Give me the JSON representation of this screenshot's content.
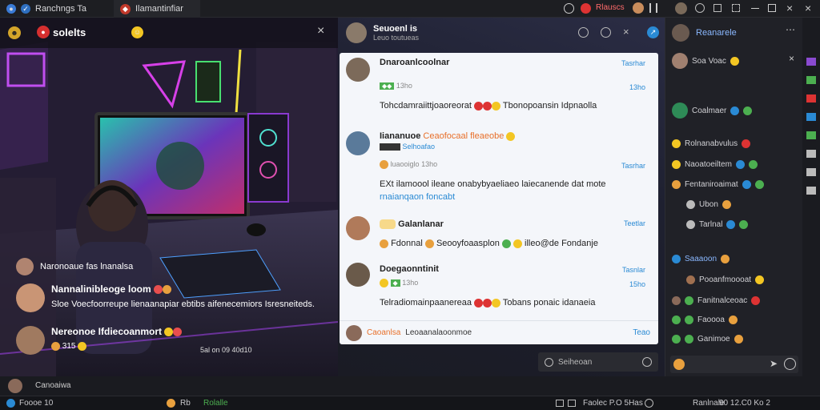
{
  "tabs": [
    {
      "label": "Ranchngs Ta",
      "icon": "app-icon"
    },
    {
      "label": "Ilamantinfiar",
      "icon": "game-icon"
    }
  ],
  "titlebar": {
    "badge_label": "Rlauscs",
    "icons": [
      "clock-icon",
      "notification-icon",
      "avatar-icon",
      "profile-icon",
      "settings-icon",
      "grid-icon",
      "minimize-icon",
      "maximize-icon",
      "close-icon"
    ]
  },
  "stream": {
    "channel": "solelts",
    "close_icon": "close-icon",
    "overlay": [
      {
        "name": "Naronoaue fas lnanalsa",
        "text": ""
      },
      {
        "name": "Nannalinibleoge loom",
        "text": "Sloe Voecfoorreupe lienaanapiar ebtibs aifenecemiors Isresneiteds."
      },
      {
        "name": "Nereonoe Ifdiecoanmort",
        "text": "315"
      }
    ],
    "overlay_time": "5al on 09 40d10",
    "bottom_user": "Canoaiwa"
  },
  "mid": {
    "header_name": "Seuoenl is",
    "header_sub": "Leuo toutueas",
    "comments": [
      {
        "name": "Dnaroanlcoolnar",
        "meta": "13ho",
        "reply": "Tasrhar",
        "body": "Tohcdamraiittjoaoreorat",
        "body2": "Tbonopoansin Idpnaolla",
        "time": "13ho"
      },
      {
        "name": "Iiananuoe",
        "tag": "Ceaofocaal fleaeobe",
        "reply": "",
        "sub": "Selhoafao",
        "meta": "luaooiglo",
        "body": "EXt ilamoool ileane onabybyaeliaeo laiecanende dat mote",
        "body2": "rnaianqaon foncabt",
        "time": "13ho",
        "reply2": "Tasrhar"
      },
      {
        "name": "Galanlanar",
        "meta": "",
        "reply": "Teetlar",
        "body": "Fdonnal",
        "body2": "Seooyfoaasplon",
        "body3": "illeo@de Fondanje",
        "time": ""
      },
      {
        "name": "Doegaonntinit",
        "meta": "",
        "reply": "Tasnlar",
        "body": "Telradiomainpaanereaa",
        "body2": "Tobans ponaic idanaeia",
        "time": "13ho",
        "time2": "15ho"
      }
    ],
    "footer_name": "Caoanlsa",
    "footer_text": "Leoaanalaoonmoe",
    "footer_reply": "Teao",
    "input_placeholder": "Seiheoan"
  },
  "right": {
    "title": "Reanarele",
    "items": [
      {
        "name": "Soa Voac",
        "sub": ""
      },
      {
        "name": "Coalmaer",
        "sub": ""
      },
      {
        "name": "Rolnanabvulus",
        "sub": ""
      },
      {
        "name": "Naoatoeiltem",
        "sub": ""
      },
      {
        "name": "Fentaniroaimat",
        "sub": ""
      },
      {
        "name": "Ubon",
        "sub": ""
      },
      {
        "name": "Tarlnal",
        "sub": ""
      },
      {
        "name": "Saaaoon",
        "sub": ""
      },
      {
        "name": "Pooanfmoooat",
        "sub": ""
      },
      {
        "name": "Fanitnalceoac",
        "sub": ""
      },
      {
        "name": "Faoooa",
        "sub": ""
      },
      {
        "name": "Ganimoe",
        "sub": ""
      }
    ]
  },
  "status": {
    "left": "Foooe 10",
    "mid1": "Rb",
    "mid2": "Rolalle",
    "right1": "Faolec P.O 5Has",
    "right2": "Ranlnale",
    "right3": "90 12.C0 Ko 2"
  }
}
